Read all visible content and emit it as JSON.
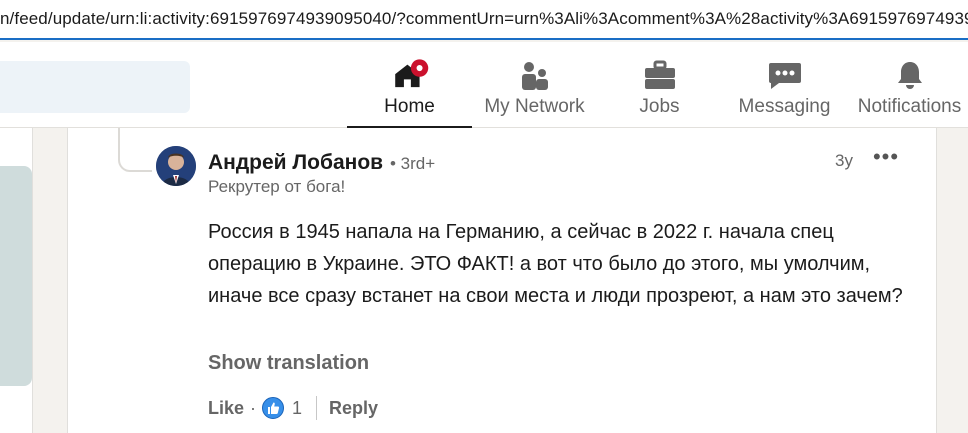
{
  "browser": {
    "url": "n/feed/update/urn:li:activity:6915976974939095040/?commentUrn=urn%3Ali%3Acomment%3A%28activity%3A6915976974939"
  },
  "nav": {
    "items": [
      {
        "label": "Home",
        "icon": "home-icon",
        "active": true,
        "notification": true
      },
      {
        "label": "My Network",
        "icon": "network-icon"
      },
      {
        "label": "Jobs",
        "icon": "briefcase-icon"
      },
      {
        "label": "Messaging",
        "icon": "messaging-icon"
      },
      {
        "label": "Notifications",
        "icon": "bell-icon"
      }
    ]
  },
  "comment": {
    "author": "Андрей Лобанов",
    "degree": "• 3rd+",
    "headline": "Рекрутер от бога!",
    "timestamp": "3y",
    "more": "•••",
    "text": "Россия в 1945 напала на Германию, а сейчас в 2022 г. начала спец операцию в Украине. ЭТО ФАКТ! а вот что было до этого, мы умолчим, иначе все сразу встанет на свои места и люди прозреют, а нам это зачем?",
    "show_translation": "Show translation",
    "like_label": "Like",
    "separator": "·",
    "reaction_count": "1",
    "reply_label": "Reply"
  },
  "colors": {
    "accent": "#1a6ec5",
    "notification_badge": "#cb112d",
    "reaction_blue": "#378fe9",
    "text_primary": "#1b1b1b",
    "text_secondary": "#666666"
  }
}
